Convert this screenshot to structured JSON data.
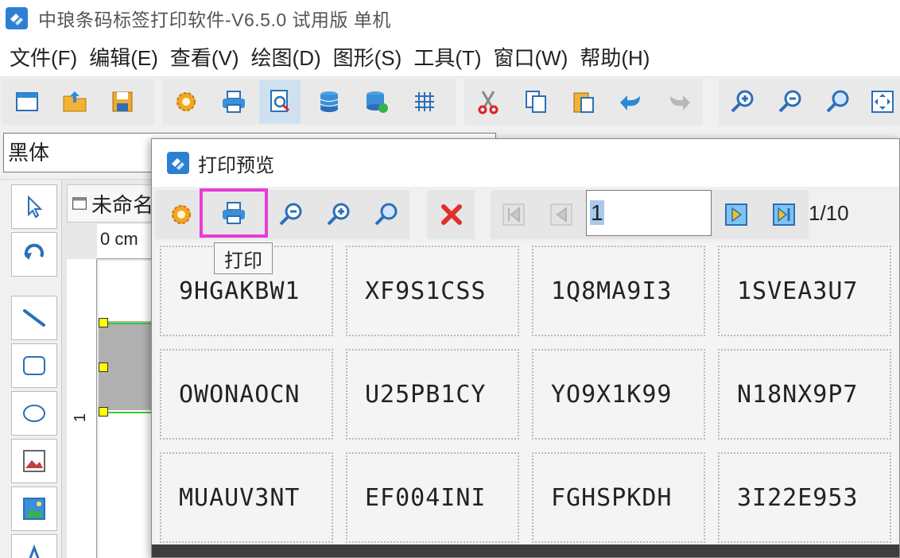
{
  "window": {
    "title": "中琅条码标签打印软件-V6.5.0 试用版 单机"
  },
  "menu": [
    {
      "label": "文件(F)",
      "name": "menu-file"
    },
    {
      "label": "编辑(E)",
      "name": "menu-edit"
    },
    {
      "label": "查看(V)",
      "name": "menu-view"
    },
    {
      "label": "绘图(D)",
      "name": "menu-draw"
    },
    {
      "label": "图形(S)",
      "name": "menu-shape"
    },
    {
      "label": "工具(T)",
      "name": "menu-tools"
    },
    {
      "label": "窗口(W)",
      "name": "menu-window"
    },
    {
      "label": "帮助(H)",
      "name": "menu-help"
    }
  ],
  "toolbar": {
    "icons": [
      "new-icon",
      "open-icon",
      "save-icon",
      "settings-icon",
      "print-icon",
      "print-preview-icon",
      "database-icon",
      "database-settings-icon",
      "grid-icon",
      "cut-icon",
      "copy-icon",
      "paste-icon",
      "undo-icon",
      "redo-icon",
      "zoom-in-icon",
      "zoom-out-icon",
      "zoom-fit-icon",
      "fit-page-icon"
    ]
  },
  "font_bar": {
    "font_value": "黑体"
  },
  "document": {
    "tab_label": "未命名",
    "ruler_unit": "0 cm",
    "ruler_marker": "1"
  },
  "preview_dialog": {
    "title": "打印预览",
    "page_input_value": "1",
    "page_count": "1/10",
    "tooltip": "打印",
    "colors": {
      "highlight_border": "#e83cd6",
      "close_x": "#e0302a"
    },
    "labels": [
      [
        "9HGAKBW1",
        "XF9S1CSS",
        "1Q8MA9I3",
        "1SVEA3U7"
      ],
      [
        "OWONAOCN",
        "U25PB1CY",
        "YO9X1K99",
        "N18NX9P7"
      ],
      [
        "MUAUV3NT",
        "EF004INI",
        "FGHSPKDH",
        "3I22E953"
      ]
    ]
  }
}
